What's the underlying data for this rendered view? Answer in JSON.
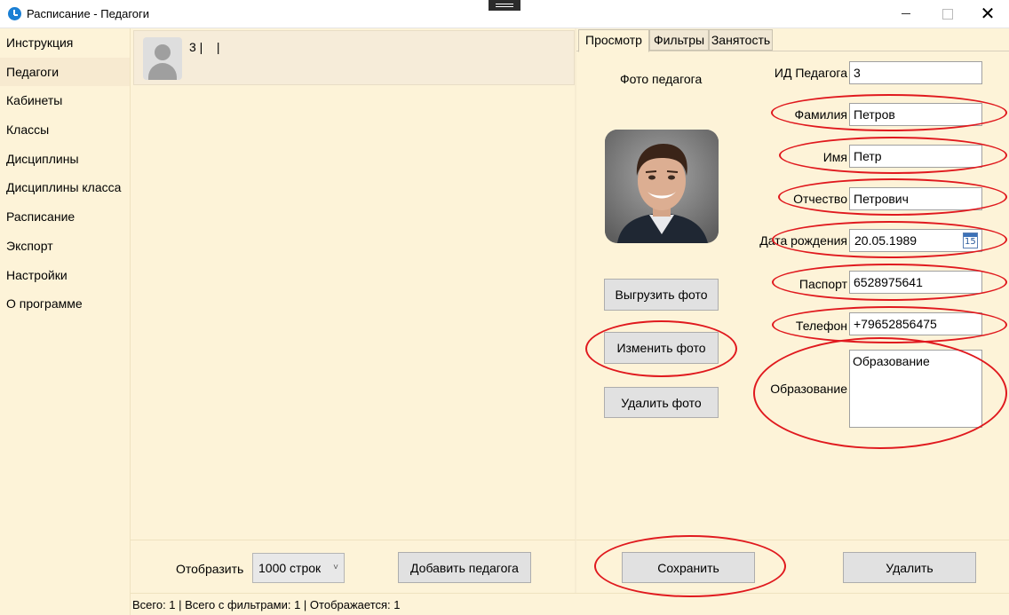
{
  "window": {
    "title": "Расписание - Педагоги",
    "close_glyph": "✕"
  },
  "sidebar": {
    "items": [
      {
        "label": "Инструкция"
      },
      {
        "label": "Педагоги"
      },
      {
        "label": "Кабинеты"
      },
      {
        "label": "Классы"
      },
      {
        "label": "Дисциплины"
      },
      {
        "label": "Дисциплины класса"
      },
      {
        "label": "Расписание"
      },
      {
        "label": "Экспорт"
      },
      {
        "label": "Настройки"
      },
      {
        "label": "О программе"
      }
    ],
    "active": "Педагоги"
  },
  "list": {
    "rows": [
      {
        "text": "3 |    |"
      }
    ]
  },
  "tabs": [
    {
      "label": "Просмотр"
    },
    {
      "label": "Фильтры"
    },
    {
      "label": "Занятость"
    }
  ],
  "active_tab": "Просмотр",
  "photo": {
    "label": "Фото педагога",
    "upload_label": "Выгрузить фото",
    "change_label": "Изменить фото",
    "delete_label": "Удалить фото"
  },
  "form": {
    "id_label": "ИД Педагога",
    "id_value": "3",
    "lastname_label": "Фамилия",
    "lastname_value": "Петров",
    "firstname_label": "Имя",
    "firstname_value": "Петр",
    "patronymic_label": "Отчество",
    "patronymic_value": "Петрович",
    "birth_label": "Дата рождения",
    "birth_value": "20.05.1989",
    "calendar_day": "15",
    "passport_label": "Паспорт",
    "passport_value": "6528975641",
    "phone_label": "Телефон",
    "phone_value": "+79652856475",
    "education_label": "Образование",
    "education_value": "Образование"
  },
  "bottom": {
    "display_label": "Отобразить",
    "rows_select": "1000 строк",
    "chevron": "˅",
    "add_label": "Добавить педагога",
    "save_label": "Сохранить",
    "delete_label": "Удалить"
  },
  "status": {
    "text": "Всего: 1 | Всего с фильтрами: 1 | Отображается: 1"
  },
  "colors": {
    "background": "#fdf3d8",
    "annotation": "#e0191e",
    "button": "#e1e1e1"
  }
}
